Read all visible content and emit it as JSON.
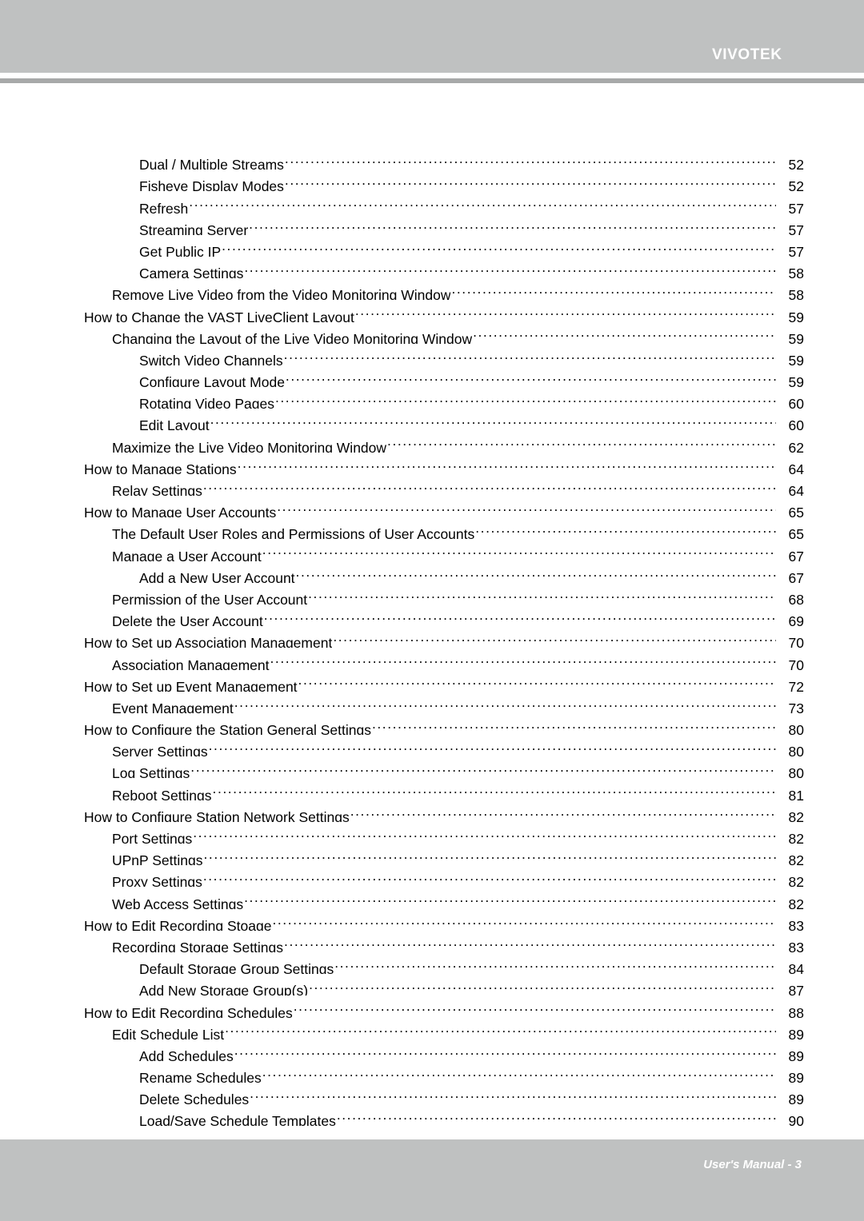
{
  "header": {
    "brand": "VIVOTEK",
    "brand_color": "#ffffff",
    "bar_color": "#bfc1c1",
    "rule_color": "#a7a9a9"
  },
  "footer": {
    "text": "User's Manual - 3",
    "bar_color": "#bfc1c1",
    "text_color": "#ffffff"
  },
  "toc": {
    "leader_char": ".",
    "entries": [
      {
        "title": "Dual / Multiple Streams",
        "page": "52",
        "level": 3
      },
      {
        "title": "Fisheye Display Modes",
        "page": "52",
        "level": 3
      },
      {
        "title": "Refresh",
        "page": "57",
        "level": 3
      },
      {
        "title": "Streaming Server",
        "page": "57",
        "level": 3
      },
      {
        "title": "Get Public IP",
        "page": "57",
        "level": 3
      },
      {
        "title": "Camera Settings",
        "page": "58",
        "level": 3
      },
      {
        "title": "Remove Live Video from the Video Monitoring Window",
        "page": "58",
        "level": 2
      },
      {
        "title": "How to Change the VAST LiveClient Layout",
        "page": "59",
        "level": 1
      },
      {
        "title": "Changing the Layout of the Live Video Monitoring Window",
        "page": "59",
        "level": 2
      },
      {
        "title": "Switch Video Channels",
        "page": "59",
        "level": 3
      },
      {
        "title": "Configure Layout Mode",
        "page": "59",
        "level": 3
      },
      {
        "title": "Rotating Video Pages",
        "page": "60",
        "level": 3
      },
      {
        "title": "Edit Layout",
        "page": "60",
        "level": 3
      },
      {
        "title": "Maximize the Live Video Monitoring Window",
        "page": "62",
        "level": 2
      },
      {
        "title": "How to Manage Stations",
        "page": "64",
        "level": 1
      },
      {
        "title": "Relay Settings",
        "page": "64",
        "level": 2
      },
      {
        "title": "How to Manage User Accounts",
        "page": "65",
        "level": 1
      },
      {
        "title": "The Default User Roles and Permissions of User Accounts",
        "page": "65",
        "level": 2
      },
      {
        "title": "Manage a User Account",
        "page": "67",
        "level": 2
      },
      {
        "title": "Add a New User Account",
        "page": "67",
        "level": 3
      },
      {
        "title": "Permission of the User Account",
        "page": "68",
        "level": 2
      },
      {
        "title": "Delete the User Account",
        "page": "69",
        "level": 2
      },
      {
        "title": "How to Set up Association Management",
        "page": "70",
        "level": 1
      },
      {
        "title": "Association Management",
        "page": "70",
        "level": 2
      },
      {
        "title": "How to Set up Event Management",
        "page": "72",
        "level": 1
      },
      {
        "title": "Event Management",
        "page": "73",
        "level": 2
      },
      {
        "title": "How to Configure the Station General Settings",
        "page": "80",
        "level": 1
      },
      {
        "title": "Server Settings",
        "page": "80",
        "level": 2
      },
      {
        "title": "Log Settings",
        "page": "80",
        "level": 2
      },
      {
        "title": "Reboot Settings",
        "page": "81",
        "level": 2
      },
      {
        "title": "How to Configure Station Network Settings",
        "page": "82",
        "level": 1
      },
      {
        "title": "Port Settings",
        "page": "82",
        "level": 2
      },
      {
        "title": "UPnP Settings",
        "page": "82",
        "level": 2
      },
      {
        "title": "Proxy Settings",
        "page": "82",
        "level": 2
      },
      {
        "title": "Web Access Settings",
        "page": "82",
        "level": 2
      },
      {
        "title": "How to Edit Recording Stoage",
        "page": "83",
        "level": 1
      },
      {
        "title": "Recording Storage Settings",
        "page": "83",
        "level": 2
      },
      {
        "title": "Default Storage Group Settings",
        "page": "84",
        "level": 3
      },
      {
        "title": "Add New Storage Group(s)",
        "page": "87",
        "level": 3
      },
      {
        "title": "How to Edit Recording Schedules",
        "page": "88",
        "level": 1
      },
      {
        "title": "Edit Schedule List",
        "page": "89",
        "level": 2
      },
      {
        "title": "Add Schedules",
        "page": "89",
        "level": 3
      },
      {
        "title": "Rename Schedules",
        "page": "89",
        "level": 3
      },
      {
        "title": "Delete Schedules",
        "page": "89",
        "level": 3
      },
      {
        "title": "Load/Save Schedule Templates",
        "page": "90",
        "level": 3
      }
    ]
  }
}
